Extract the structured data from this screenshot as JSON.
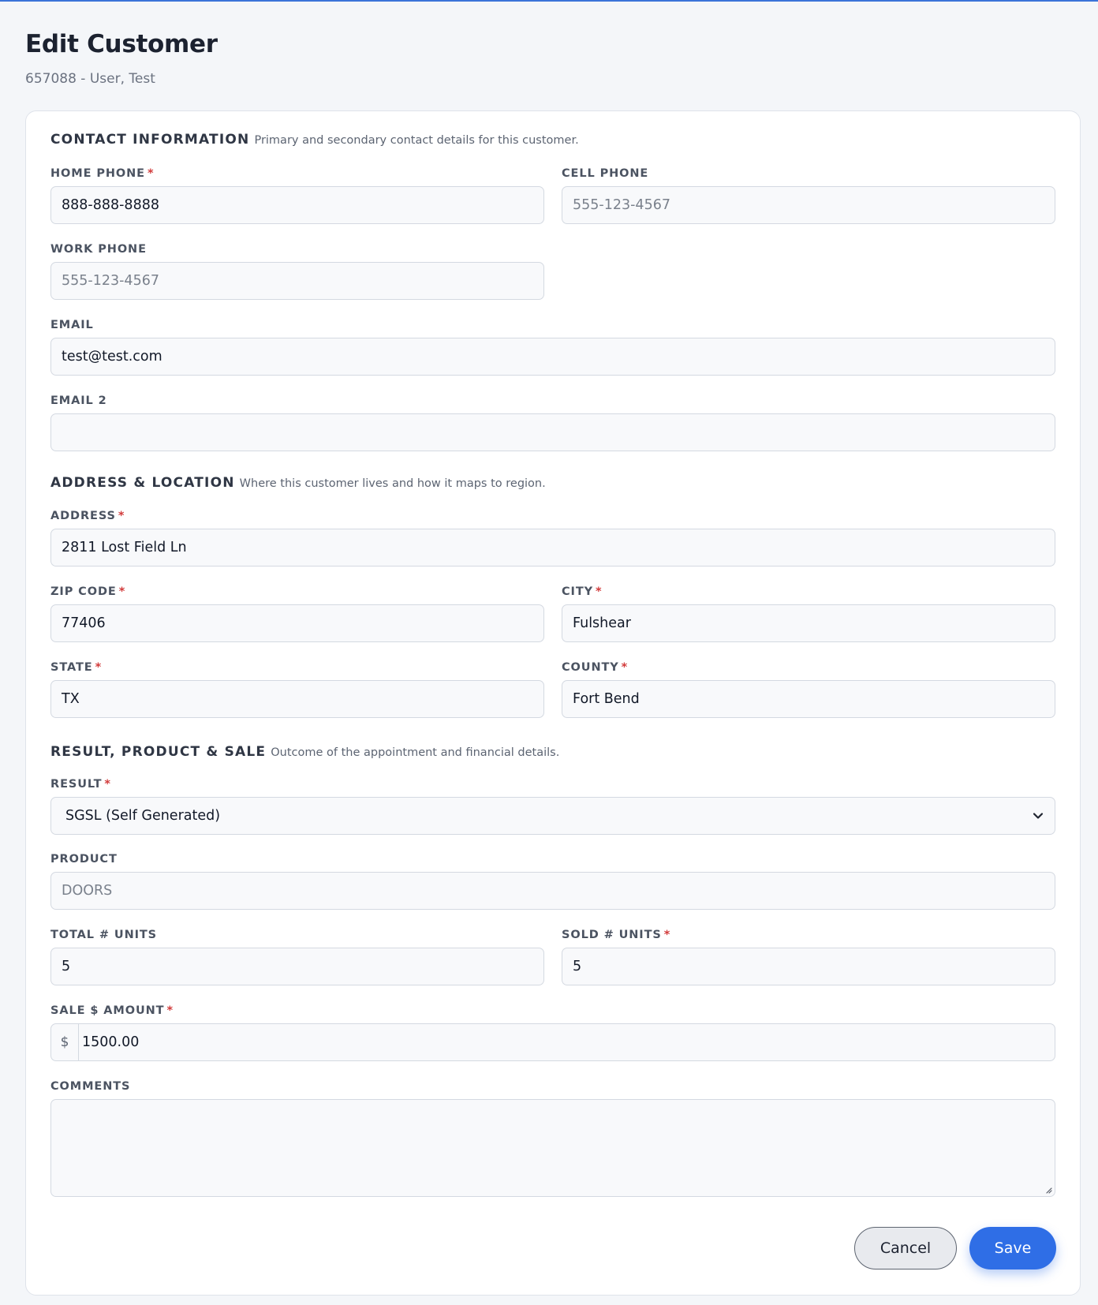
{
  "header": {
    "title": "Edit Customer",
    "subtitle": "657088 - User, Test"
  },
  "sections": {
    "contact": {
      "title": "CONTACT INFORMATION",
      "description": "Primary and secondary contact details for this customer."
    },
    "address": {
      "title": "ADDRESS & LOCATION",
      "description": "Where this customer lives and how it maps to region."
    },
    "result": {
      "title": "RESULT, PRODUCT & SALE",
      "description": "Outcome of the appointment and financial details."
    }
  },
  "required_marker": "*",
  "fields": {
    "home_phone": {
      "label": "HOME PHONE",
      "value": "888-888-8888",
      "required": true
    },
    "cell_phone": {
      "label": "CELL PHONE",
      "value": "",
      "placeholder": "555-123-4567"
    },
    "work_phone": {
      "label": "WORK PHONE",
      "value": "",
      "placeholder": "555-123-4567"
    },
    "email": {
      "label": "EMAIL",
      "value": "test@test.com"
    },
    "email2": {
      "label": "EMAIL 2",
      "value": ""
    },
    "address": {
      "label": "ADDRESS",
      "value": "2811 Lost Field Ln",
      "required": true
    },
    "zip": {
      "label": "ZIP CODE",
      "value": "77406",
      "required": true
    },
    "city": {
      "label": "CITY",
      "value": "Fulshear",
      "required": true
    },
    "state": {
      "label": "STATE",
      "value": "TX",
      "required": true
    },
    "county": {
      "label": "COUNTY",
      "value": "Fort Bend",
      "required": true
    },
    "result": {
      "label": "RESULT",
      "value": "SGSL (Self Generated)",
      "required": true
    },
    "product": {
      "label": "PRODUCT",
      "value": "DOORS"
    },
    "total_units": {
      "label": "TOTAL # UNITS",
      "value": "5"
    },
    "sold_units": {
      "label": "SOLD # UNITS",
      "value": "5",
      "required": true
    },
    "sale_amount": {
      "label": "SALE $ AMOUNT",
      "prefix": "$",
      "value": "1500.00",
      "required": true
    },
    "comments": {
      "label": "COMMENTS",
      "value": ""
    }
  },
  "actions": {
    "cancel": "Cancel",
    "save": "Save"
  },
  "colors": {
    "accent": "#2f6ee6",
    "required": "#d23b3b",
    "background": "#f4f6f9"
  },
  "icons": {
    "select": "chevron-down-icon",
    "resize": "resize-grip-icon"
  }
}
